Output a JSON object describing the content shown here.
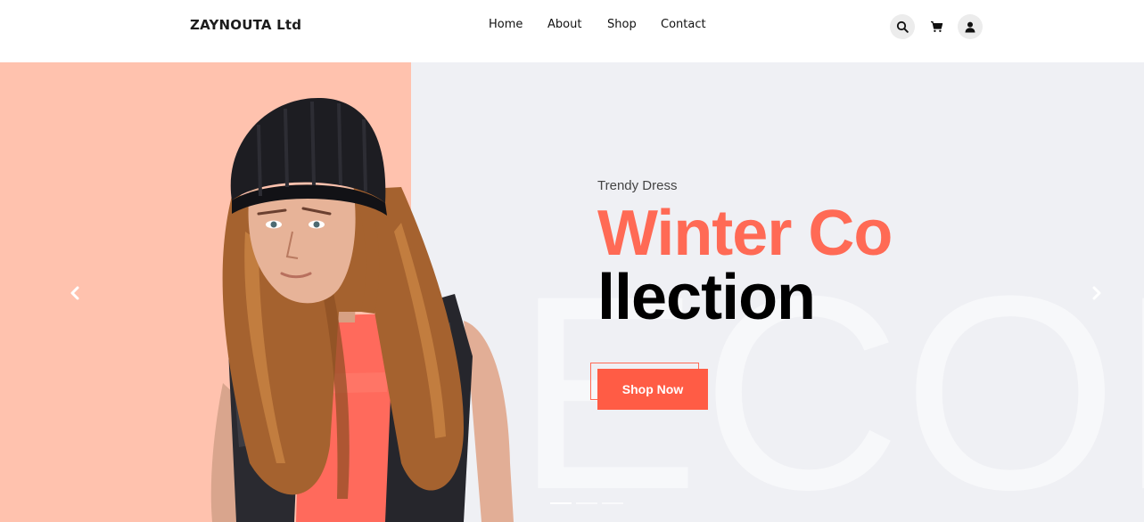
{
  "header": {
    "brand": "ZAYNOUTA Ltd",
    "nav": [
      "Home",
      "About",
      "Shop",
      "Contact"
    ],
    "icons": [
      "search-icon",
      "cart-icon",
      "user-icon"
    ]
  },
  "hero": {
    "subtitle": "Trendy Dress",
    "title_line1": "Winter Co",
    "title_line2": "llection",
    "cta_label": "Shop Now",
    "background_word": "ECOM",
    "colors": {
      "accent": "#ff6a55",
      "left_panel": "#ffc2ae",
      "hero_bg": "#eff0f4"
    },
    "slide_count": 3,
    "active_slide": 1
  }
}
